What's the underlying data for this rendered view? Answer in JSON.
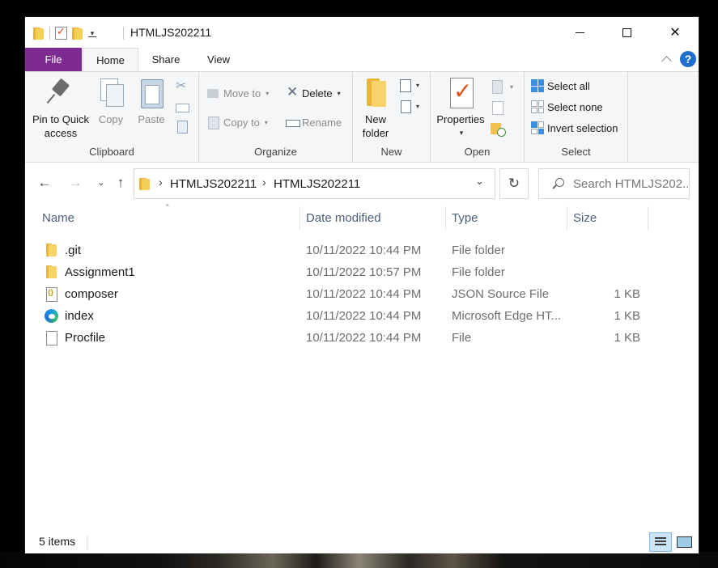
{
  "window": {
    "title": "HTMLJS202211",
    "controls": [
      "minimize",
      "maximize",
      "close"
    ]
  },
  "quick_access_toolbar": {
    "icons": [
      "folder-icon",
      "properties-icon",
      "new-folder-icon",
      "customize-dropdown-icon"
    ]
  },
  "ribbon": {
    "tabs": [
      {
        "label": "File",
        "active": false
      },
      {
        "label": "Home",
        "active": true
      },
      {
        "label": "Share",
        "active": false
      },
      {
        "label": "View",
        "active": false
      }
    ],
    "clipboard": {
      "label": "Clipboard",
      "pin_label_1": "Pin to Quick",
      "pin_label_2": "access",
      "copy_label": "Copy",
      "paste_label": "Paste"
    },
    "organize": {
      "label": "Organize",
      "move_to": "Move to",
      "copy_to": "Copy to",
      "delete": "Delete",
      "rename": "Rename"
    },
    "new": {
      "label": "New",
      "new_folder_1": "New",
      "new_folder_2": "folder"
    },
    "open": {
      "label": "Open",
      "properties": "Properties"
    },
    "select": {
      "label": "Select",
      "select_all": "Select all",
      "select_none": "Select none",
      "invert_selection": "Invert selection"
    }
  },
  "address_bar": {
    "breadcrumbs": [
      "HTMLJS202211",
      "HTMLJS202211"
    ]
  },
  "search": {
    "placeholder": "Search HTMLJS202..."
  },
  "columns": {
    "name": "Name",
    "date_modified": "Date modified",
    "type": "Type",
    "size": "Size"
  },
  "files": [
    {
      "name": ".git",
      "date": "10/11/2022 10:44 PM",
      "type": "File folder",
      "size": "",
      "icon": "folder-icon"
    },
    {
      "name": "Assignment1",
      "date": "10/11/2022 10:57 PM",
      "type": "File folder",
      "size": "",
      "icon": "folder-icon"
    },
    {
      "name": "composer",
      "date": "10/11/2022 10:44 PM",
      "type": "JSON Source File",
      "size": "1 KB",
      "icon": "json-file-icon"
    },
    {
      "name": "index",
      "date": "10/11/2022 10:44 PM",
      "type": "Microsoft Edge HT...",
      "size": "1 KB",
      "icon": "edge-icon"
    },
    {
      "name": "Procfile",
      "date": "10/11/2022 10:44 PM",
      "type": "File",
      "size": "1 KB",
      "icon": "file-icon"
    }
  ],
  "status": {
    "item_count": "5 items"
  }
}
